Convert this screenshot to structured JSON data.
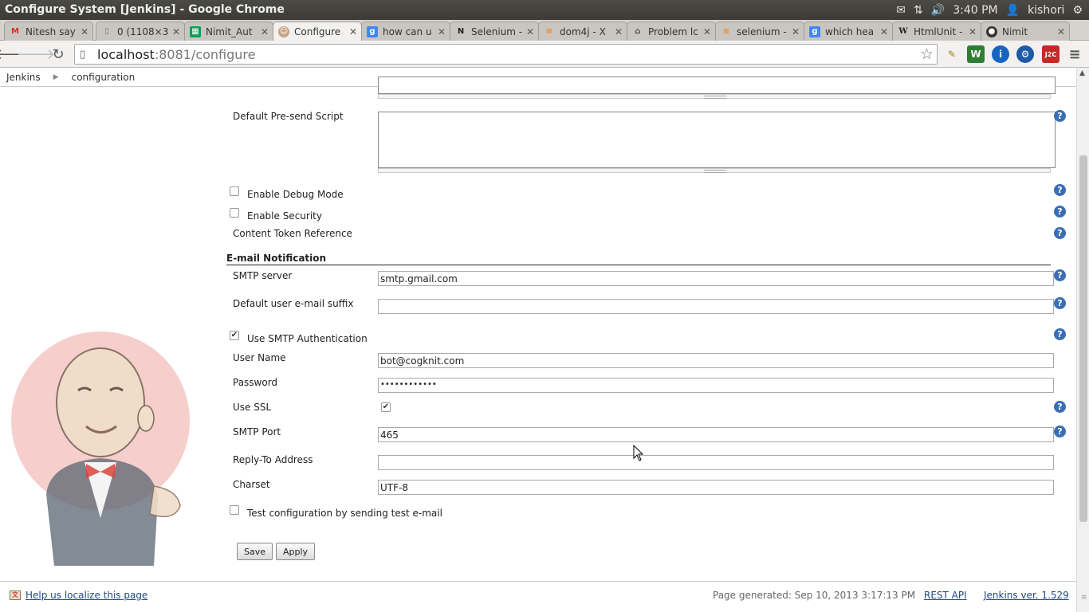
{
  "window": {
    "title": "Configure System [Jenkins] - Google Chrome",
    "tray": {
      "time": "3:40 PM",
      "user": "kishori"
    }
  },
  "tabs": [
    {
      "label": "Nitesh say",
      "icon": "gmail-icon",
      "color": "#d93025"
    },
    {
      "label": "0 (1108×3",
      "icon": "document-icon",
      "color": "#777777"
    },
    {
      "label": "Nimit_Aut",
      "icon": "sheets-icon",
      "color": "#0f9d58"
    },
    {
      "label": "Configure",
      "icon": "jenkins-icon",
      "color": "#c9a27e"
    },
    {
      "label": "how can u",
      "icon": "google-icon",
      "color": "#4285f4"
    },
    {
      "label": "Selenium -",
      "icon": "notion-icon",
      "color": "#222222"
    },
    {
      "label": "dom4j - X",
      "icon": "stackoverflow-icon",
      "color": "#f48024"
    },
    {
      "label": "Problem lc",
      "icon": "site-icon",
      "color": "#444444"
    },
    {
      "label": "selenium -",
      "icon": "stackoverflow-icon",
      "color": "#f48024"
    },
    {
      "label": "which hea",
      "icon": "google-icon",
      "color": "#4285f4"
    },
    {
      "label": "HtmlUnit -",
      "icon": "wikipedia-icon",
      "color": "#222222"
    },
    {
      "label": "Nimit",
      "icon": "github-icon",
      "color": "#333333"
    }
  ],
  "address": {
    "host": "localhost",
    "path": ":8081/configure"
  },
  "breadcrumb": [
    "Jenkins",
    "configuration"
  ],
  "form": {
    "pre_send_label": "Default Pre-send Script",
    "debug_label": "Enable Debug Mode",
    "security_label": "Enable Security",
    "token_label": "Content Token Reference",
    "section_title": "E-mail Notification",
    "smtp_server_label": "SMTP server",
    "smtp_server_value": "smtp.gmail.com",
    "suffix_label": "Default user e-mail suffix",
    "suffix_value": "",
    "smtp_auth_label": "Use SMTP Authentication",
    "username_label": "User Name",
    "username_value": "bot@cogknit.com",
    "password_label": "Password",
    "password_mask": "••••••••••••",
    "ssl_label": "Use SSL",
    "port_label": "SMTP Port",
    "port_value": "465",
    "reply_to_label": "Reply-To Address",
    "reply_to_value": "",
    "charset_label": "Charset",
    "charset_value": "UTF-8",
    "test_label": "Test configuration by sending test e-mail",
    "save_label": "Save",
    "apply_label": "Apply",
    "help_glyph": "?"
  },
  "footer": {
    "localize": "Help us localize this page",
    "generated": "Page generated: Sep 10, 2013 3:17:13 PM",
    "rest_api": "REST API",
    "version": "Jenkins ver. 1.529"
  }
}
